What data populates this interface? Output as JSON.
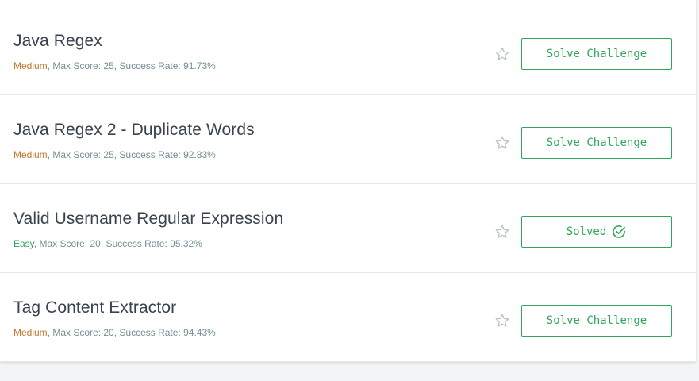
{
  "colors": {
    "accent_green": "#2ea858",
    "medium": "#c6742c",
    "easy": "#2da160",
    "meta": "#738f93",
    "title": "#39424e"
  },
  "challenges": [
    {
      "title": "Java Regex",
      "difficulty": "Medium",
      "rest": ", Max Score: 25, Success Rate: 91.73%",
      "button": "Solve Challenge",
      "solved": false,
      "star_icon": "star-outline-icon"
    },
    {
      "title": "Java Regex 2 - Duplicate Words",
      "difficulty": "Medium",
      "rest": ", Max Score: 25, Success Rate: 92.83%",
      "button": "Solve Challenge",
      "solved": false,
      "star_icon": "star-outline-icon"
    },
    {
      "title": "Valid Username Regular Expression",
      "difficulty": "Easy",
      "rest": ", Max Score: 20, Success Rate: 95.32%",
      "button": "Solved",
      "solved": true,
      "star_icon": "star-outline-icon",
      "button_icon": "check-circle-icon"
    },
    {
      "title": "Tag Content Extractor",
      "difficulty": "Medium",
      "rest": ", Max Score: 20, Success Rate: 94.43%",
      "button": "Solve Challenge",
      "solved": false,
      "star_icon": "star-outline-icon"
    }
  ]
}
